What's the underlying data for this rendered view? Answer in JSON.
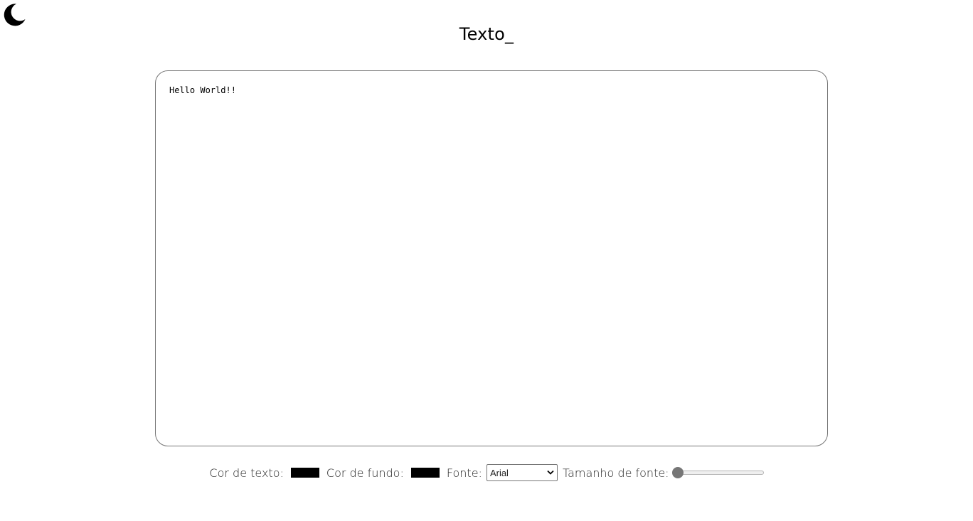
{
  "header": {
    "theme_toggle_icon": "moon-icon",
    "title": "Texto_"
  },
  "editor": {
    "content": "Hello World!!"
  },
  "controls": {
    "text_color_label": "Cor de texto:",
    "text_color_value": "#000000",
    "bg_color_label": "Cor de fundo:",
    "bg_color_value": "#000000",
    "font_label": "Fonte:",
    "font_selected": "Arial",
    "font_size_label": "Tamanho de fonte:",
    "font_size_level": 0
  }
}
